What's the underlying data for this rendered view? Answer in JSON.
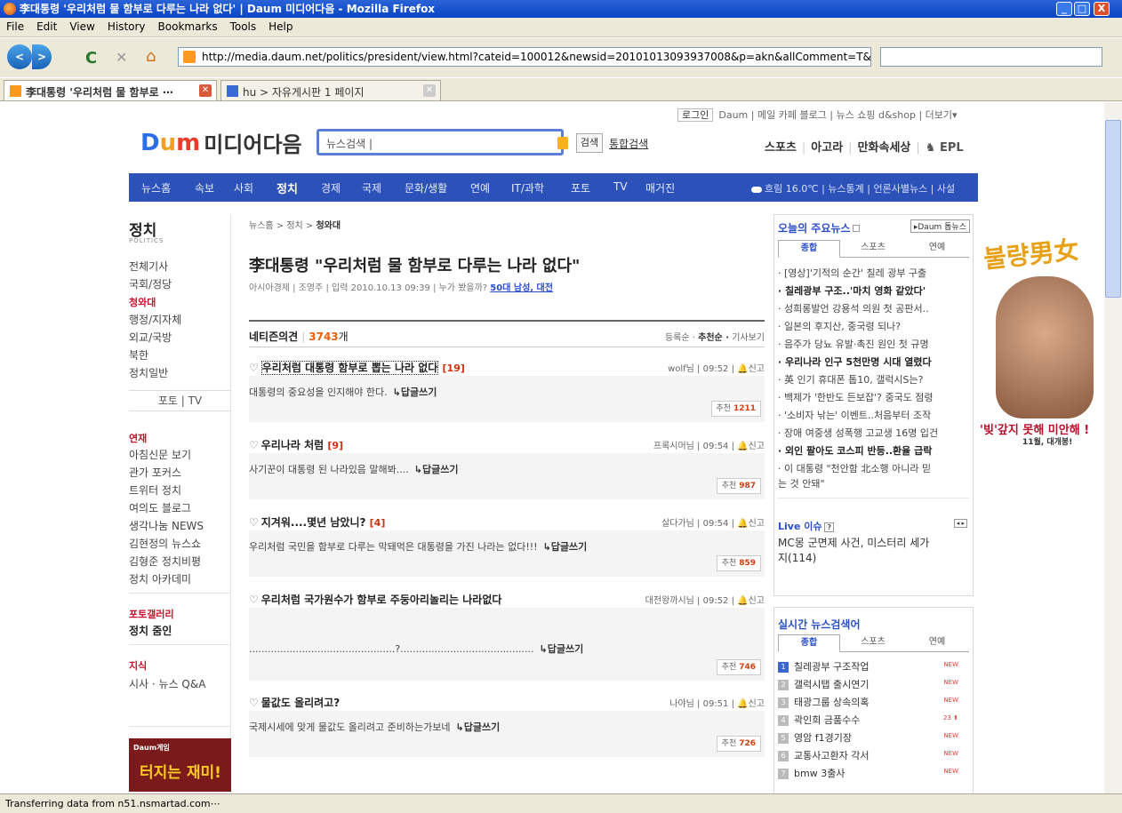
{
  "window": {
    "title": "李대통령 '우리처럼 물 함부로 다루는 나라 없다' | Daum 미디어다음 - Mozilla Firefox",
    "min": "_",
    "max": "□",
    "close": "X"
  },
  "menu": [
    "File",
    "Edit",
    "View",
    "History",
    "Bookmarks",
    "Tools",
    "Help"
  ],
  "nav": {
    "url": "http://media.daum.net/politics/president/view.html?cateid=100012&newsid=20101013093937008&p=akn&allComment=T&commentVie",
    "back": "<",
    "fwd": ">",
    "reload": "C",
    "stop": "✕",
    "home": "⌂"
  },
  "tabs": [
    {
      "label": "李대통령 '우리처럼 물 함부로 ⋯",
      "close": "✕"
    },
    {
      "label": "hu > 자유게시판 1 페이지",
      "close": "✕"
    }
  ],
  "status": "Transferring data from n51.nsmartad.com⋯",
  "util": {
    "login": "로그인",
    "links": "Daum | 메일  카페  블로그 | 뉴스  쇼핑  d&shop | 더보기▾"
  },
  "logo": {
    "d": "D",
    "m": "m",
    "um": "u",
    "name": "미디어다음"
  },
  "search": {
    "placeholder": "뉴스검색 |",
    "button": "검색",
    "total": "통합검색"
  },
  "toplinks": {
    "sports": "스포츠",
    "agora": "아고라",
    "manhwa": "만화속세상",
    "epl": "EPL"
  },
  "gnb": {
    "items": [
      "뉴스홈",
      "속보",
      "사회",
      "정치",
      "경제",
      "국제",
      "문화/생활",
      "연예",
      "IT/과학",
      "포토",
      "TV",
      "매거진"
    ],
    "weather": "흐림 16.0℃ | 뉴스통계 | 언론사별뉴스 | 사설"
  },
  "lnav": {
    "title": "정치",
    "sub": "POLITICS",
    "items": [
      "전체기사",
      "국회/정당",
      "청와대",
      "행정/지자체",
      "외교/국방",
      "북한",
      "정치일반"
    ],
    "photo": "포토  |  TV",
    "series_title": "연재",
    "series": [
      "아침신문 보기",
      "관가 포커스",
      "트위터 정치",
      "여의도 블로그",
      "생각나눔 NEWS",
      "김현정의 뉴스쇼",
      "김형준 정치비평",
      "정치 아카데미"
    ],
    "gallery_title": "포토갤러리",
    "gallery": "정치 줌인",
    "knowledge_title": "지식",
    "knowledge": "시사 · 뉴스 Q&A",
    "ad_brand": "Daum게임",
    "ad_text": "터지는 재미!"
  },
  "article": {
    "crumb_prefix": "뉴스홈 > 정치 > ",
    "crumb_current": "청와대",
    "headline": "李대통령 \"우리처럼 물 함부로 다루는 나라 없다\"",
    "meta": "아시아경제 | 조영주 | 입력 2010.10.13 09:39 | 누가 봤을까? ",
    "meta_link": "50대 남성, 대전"
  },
  "comments_header": {
    "label": "네티즌의견",
    "count": "3743",
    "unit": "개",
    "sort": "등록순 · ",
    "sort_sel": "추천순 ·",
    "view": " 기사보기"
  },
  "comments": [
    {
      "title": "우리처럼 대통령 함부로 뽑는 나라 없다",
      "count": "[19]",
      "meta": "wolf님 | 09:52 | 🔔신고",
      "text": "대통령의 중요성을 인지해야 한다.",
      "reply": "↳답글쓰기",
      "rec_label": "추천 ",
      "rec": "1211"
    },
    {
      "title": "우리나라 처럼",
      "count": "[9]",
      "meta": "프록시머님 | 09:54 | 🔔신고",
      "text": "사기꾼이 대통령 된 나라있음 말해봐....",
      "reply": "↳답글쓰기",
      "rec_label": "추천 ",
      "rec": "987"
    },
    {
      "title": "지겨워....몇년 남았니?",
      "count": "[4]",
      "meta": "살다가님 | 09:54 | 🔔신고",
      "text": "우리처럼 국민을 함부로 다루는 막돼먹은 대통령을 가진 나라는 없다!!!",
      "reply": "↳답글쓰기",
      "rec_label": "추천 ",
      "rec": "859"
    },
    {
      "title": "우리처럼 국가원수가 함부로 주둥아리놀리는 나라없다",
      "count": "",
      "meta": "대전왕까시님 | 09:52 | 🔔신고",
      "text": "...............................................?...........................................",
      "reply": "↳답글쓰기",
      "rec_label": "추천 ",
      "rec": "746"
    },
    {
      "title": "물값도 올리려고?",
      "count": "",
      "meta": "나야님 | 09:51 | 🔔신고",
      "text": "국제시세에 맞게 물값도 올리려고 준비하는가보네",
      "reply": "↳답글쓰기",
      "rec_label": "추천 ",
      "rec": "726"
    }
  ],
  "today": {
    "title": "오늘의 주요뉴스",
    "daum_btn": "▸Daum 톱뉴스",
    "tabs": [
      "종합",
      "스포츠",
      "연예"
    ],
    "items": [
      "· [영상]'기적의 순간' 칠레 광부 구출",
      "· 칠레광부 구조..'마치 영화 같았다'",
      "· 성희롱발언 강용석 의원 첫 공판서..",
      "· 일본의 후지산, 중국령 되나?",
      "· 음주가 당뇨 유발·촉진 원인 첫 규명",
      "· 우리나라 인구 5천만명 시대 열렸다",
      "· 英 인기 휴대폰 톱10, 갤럭시S는?",
      "· 백제가 '한반도 든보잡'? 중국도 점령",
      "· '소비자 낚는' 이벤트..처음부터 조작",
      "· 장애 여중생 성폭행 고교생 16명 입건",
      "· 외인 팔아도 코스피 반등..환율 급락",
      "· 이 대통령 \"천안함 北소행 아니라 믿",
      "  는 것 안돼\""
    ],
    "live_title": "Live 이슈",
    "live_q": "?",
    "live_arrows": "◂ ▸",
    "live_text1": "MC몽 군면제 사건, 미스터리 세가",
    "live_text2": "지(114)"
  },
  "realtime": {
    "title": "실시간 뉴스검색어",
    "tabs": [
      "종합",
      "스포츠",
      "연예"
    ],
    "items": [
      {
        "n": "1",
        "text": "칠레광부 구조작업",
        "tag": "NEW"
      },
      {
        "n": "2",
        "text": "갤럭시탭 출시연기",
        "tag": "NEW"
      },
      {
        "n": "3",
        "text": "태광그룹 상속의혹",
        "tag": "NEW"
      },
      {
        "n": "4",
        "text": "곽인희 금품수수",
        "tag": "23 ⬆"
      },
      {
        "n": "5",
        "text": "영암 f1경기장",
        "tag": "NEW"
      },
      {
        "n": "6",
        "text": "교통사고환자 각서",
        "tag": "NEW"
      },
      {
        "n": "7",
        "text": "bmw 3출사",
        "tag": "NEW"
      }
    ]
  },
  "banner": {
    "logo": "불량男女",
    "slogan": "'빚'갚지 못해 미안해 !",
    "sub": "11월, 대개봉!"
  }
}
